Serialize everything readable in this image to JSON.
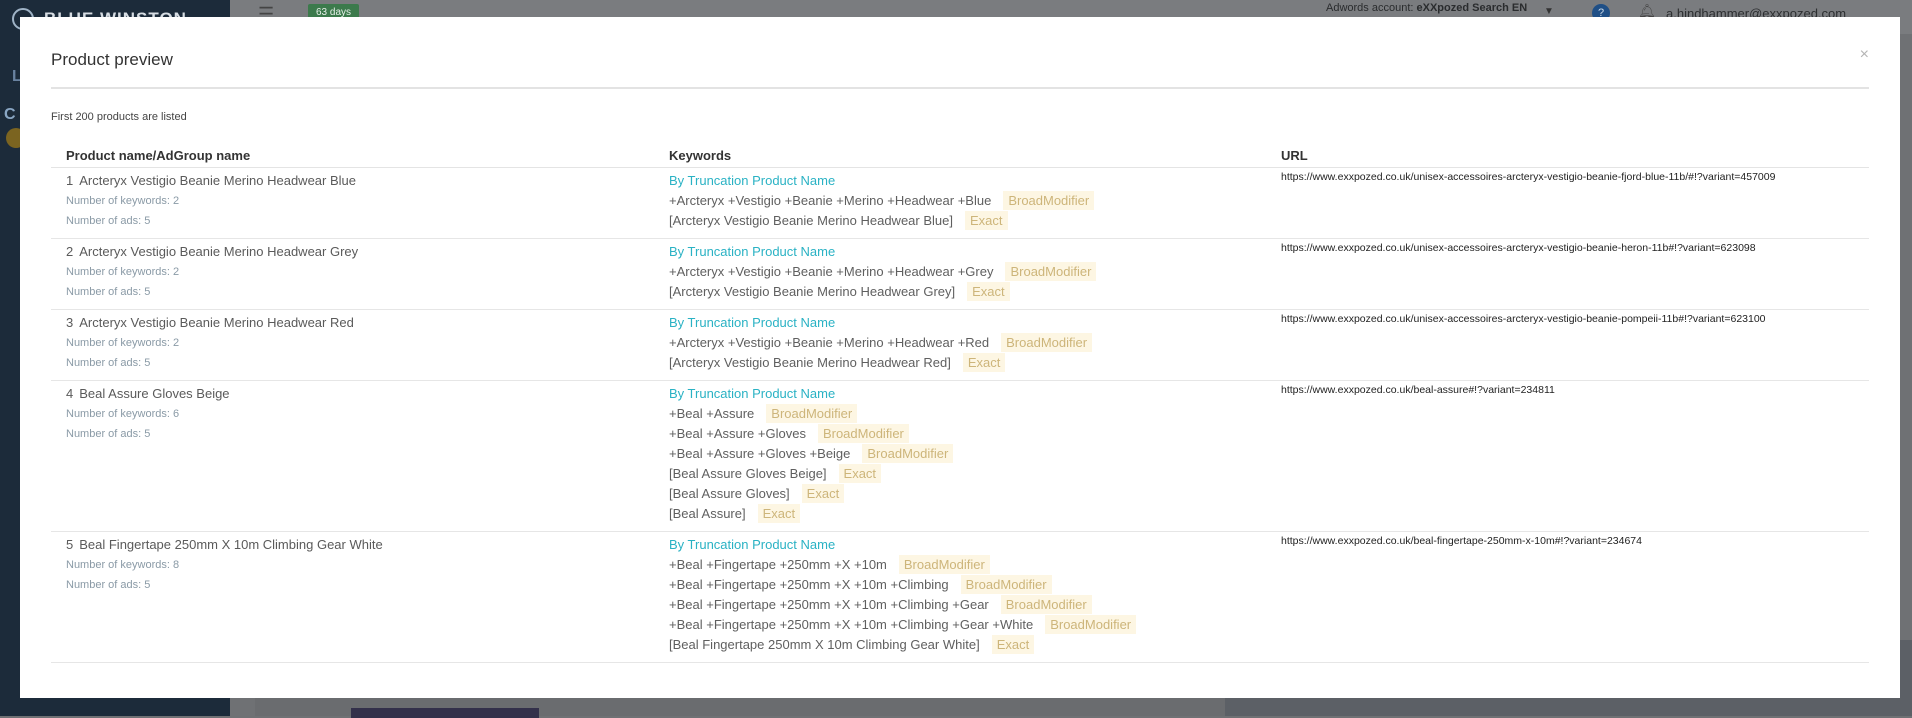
{
  "background": {
    "logo_text": "BLUE WINSTON",
    "trial_badge": "63 days",
    "adwords_label": "Adwords account:",
    "adwords_account": "eXXpozed Search EN",
    "help_count": "?",
    "user_email": "a.hindhammer@exxpozed.com",
    "side_letter_1": "L",
    "side_letter_2": "C"
  },
  "modal": {
    "title": "Product preview",
    "close_label": "×",
    "note": "First 200 products are listed",
    "columns": [
      "Product name/AdGroup name",
      "Keywords",
      "URL"
    ],
    "products": [
      {
        "num": "1",
        "name": "Arcteryx Vestigio Beanie Merino Headwear Blue",
        "keywords_count": "Number of keywords: 2",
        "ads_count": "Number of ads: 5",
        "group": "By Truncation Product Name",
        "keywords": [
          {
            "text": "+Arcteryx +Vestigio +Beanie +Merino +Headwear +Blue",
            "match": "BroadModifier"
          },
          {
            "text": "[Arcteryx Vestigio Beanie Merino Headwear Blue]",
            "match": "Exact"
          }
        ],
        "url": "https://www.exxpozed.co.uk/unisex-accessoires-arcteryx-vestigio-beanie-fjord-blue-11b/#!?variant=457009"
      },
      {
        "num": "2",
        "name": "Arcteryx Vestigio Beanie Merino Headwear Grey",
        "keywords_count": "Number of keywords: 2",
        "ads_count": "Number of ads: 5",
        "group": "By Truncation Product Name",
        "keywords": [
          {
            "text": "+Arcteryx +Vestigio +Beanie +Merino +Headwear +Grey",
            "match": "BroadModifier"
          },
          {
            "text": "[Arcteryx Vestigio Beanie Merino Headwear Grey]",
            "match": "Exact"
          }
        ],
        "url": "https://www.exxpozed.co.uk/unisex-accessoires-arcteryx-vestigio-beanie-heron-11b#!?variant=623098"
      },
      {
        "num": "3",
        "name": "Arcteryx Vestigio Beanie Merino Headwear Red",
        "keywords_count": "Number of keywords: 2",
        "ads_count": "Number of ads: 5",
        "group": "By Truncation Product Name",
        "keywords": [
          {
            "text": "+Arcteryx +Vestigio +Beanie +Merino +Headwear +Red",
            "match": "BroadModifier"
          },
          {
            "text": "[Arcteryx Vestigio Beanie Merino Headwear Red]",
            "match": "Exact"
          }
        ],
        "url": "https://www.exxpozed.co.uk/unisex-accessoires-arcteryx-vestigio-beanie-pompeii-11b#!?variant=623100"
      },
      {
        "num": "4",
        "name": "Beal Assure Gloves Beige",
        "keywords_count": "Number of keywords: 6",
        "ads_count": "Number of ads: 5",
        "group": "By Truncation Product Name",
        "keywords": [
          {
            "text": "+Beal +Assure",
            "match": "BroadModifier"
          },
          {
            "text": "+Beal +Assure +Gloves",
            "match": "BroadModifier"
          },
          {
            "text": "+Beal +Assure +Gloves +Beige",
            "match": "BroadModifier"
          },
          {
            "text": "[Beal Assure Gloves Beige]",
            "match": "Exact"
          },
          {
            "text": "[Beal Assure Gloves]",
            "match": "Exact"
          },
          {
            "text": "[Beal Assure]",
            "match": "Exact"
          }
        ],
        "url": "https://www.exxpozed.co.uk/beal-assure#!?variant=234811"
      },
      {
        "num": "5",
        "name": "Beal Fingertape 250mm X 10m Climbing Gear White",
        "keywords_count": "Number of keywords: 8",
        "ads_count": "Number of ads: 5",
        "group": "By Truncation Product Name",
        "keywords": [
          {
            "text": "+Beal +Fingertape +250mm +X +10m",
            "match": "BroadModifier"
          },
          {
            "text": "+Beal +Fingertape +250mm +X +10m +Climbing",
            "match": "BroadModifier"
          },
          {
            "text": "+Beal +Fingertape +250mm +X +10m +Climbing +Gear",
            "match": "BroadModifier"
          },
          {
            "text": "+Beal +Fingertape +250mm +X +10m +Climbing +Gear +White",
            "match": "BroadModifier"
          },
          {
            "text": "[Beal Fingertape 250mm X 10m Climbing Gear White]",
            "match": "Exact"
          }
        ],
        "url": "https://www.exxpozed.co.uk/beal-fingertape-250mm-x-10m#!?variant=234674"
      }
    ]
  }
}
